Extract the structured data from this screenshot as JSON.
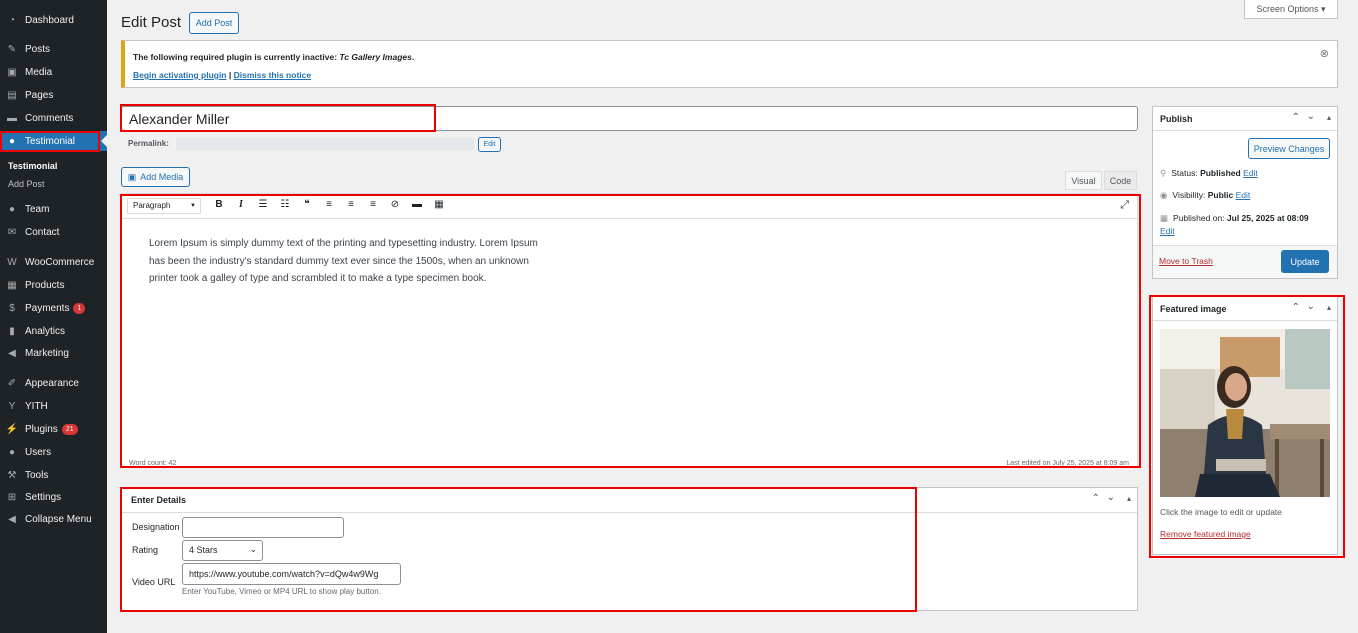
{
  "sidebar": {
    "items": [
      {
        "label": "Dashboard",
        "icon": "dashboard-icon",
        "glyph": "◔"
      },
      {
        "label": "Posts",
        "icon": "pin-icon",
        "glyph": "✎"
      },
      {
        "label": "Media",
        "icon": "media-icon",
        "glyph": "▣"
      },
      {
        "label": "Pages",
        "icon": "pages-icon",
        "glyph": "▤"
      },
      {
        "label": "Comments",
        "icon": "comments-icon",
        "glyph": "▬"
      },
      {
        "label": "Testimonial",
        "icon": "user-icon",
        "glyph": "●"
      },
      {
        "label": "Team",
        "icon": "team-icon",
        "glyph": "●"
      },
      {
        "label": "Contact",
        "icon": "mail-icon",
        "glyph": "✉"
      },
      {
        "label": "WooCommerce",
        "icon": "woo-icon",
        "glyph": "W"
      },
      {
        "label": "Products",
        "icon": "products-icon",
        "glyph": "▦"
      },
      {
        "label": "Payments",
        "icon": "payments-icon",
        "glyph": "$",
        "badge": "1"
      },
      {
        "label": "Analytics",
        "icon": "analytics-icon",
        "glyph": "▮"
      },
      {
        "label": "Marketing",
        "icon": "megaphone-icon",
        "glyph": "◀"
      },
      {
        "label": "Appearance",
        "icon": "brush-icon",
        "glyph": "✐"
      },
      {
        "label": "YITH",
        "icon": "yith-icon",
        "glyph": "Y"
      },
      {
        "label": "Plugins",
        "icon": "plugin-icon",
        "glyph": "⚡",
        "badge": "21"
      },
      {
        "label": "Users",
        "icon": "users-icon",
        "glyph": "●"
      },
      {
        "label": "Tools",
        "icon": "wrench-icon",
        "glyph": "⚒"
      },
      {
        "label": "Settings",
        "icon": "settings-icon",
        "glyph": "⊞"
      },
      {
        "label": "Collapse Menu",
        "icon": "collapse-icon",
        "glyph": "◀"
      }
    ],
    "submenu": [
      "Testimonial",
      "Add Post"
    ]
  },
  "header": {
    "title": "Edit Post",
    "add_post": "Add Post",
    "screen_options": "Screen Options ▾"
  },
  "notice": {
    "text_prefix": "The following required plugin is currently inactive: ",
    "plugin": "Tc Gallery Images",
    "text_suffix": ".",
    "link1": "Begin activating plugin",
    "sep": " | ",
    "link2": "Dismiss this notice",
    "dismiss_glyph": "⊗"
  },
  "post": {
    "title": "Alexander Miller",
    "permalink_label": "Permalink:",
    "permalink_edit": "Edit"
  },
  "editor": {
    "add_media": "Add Media",
    "tab_visual": "Visual",
    "tab_code": "Code",
    "format": "Paragraph",
    "toolbar": [
      "B",
      "I",
      "☰",
      "☷",
      "❝",
      "≡",
      "≡",
      "≡",
      "⊘",
      "▬",
      "▦"
    ],
    "content": "Lorem Ipsum is simply dummy text of the printing and typesetting industry. Lorem Ipsum has been the industry's standard dummy text ever since the 1500s, when an unknown printer took a galley of type and scrambled it to make a type specimen book.",
    "word_count": "Word count: 42",
    "last_edited": "Last edited on July 25, 2025 at 8:09 am",
    "fullscreen_glyph": "⤢"
  },
  "details": {
    "title": "Enter Details",
    "designation_label": "Designation",
    "designation_value": "",
    "rating_label": "Rating",
    "rating_value": "4 Stars",
    "video_label": "Video URL",
    "video_value": "https://www.youtube.com/watch?v=dQw4w9Wg",
    "video_hint": "Enter YouTube, Vimeo or MP4 URL to show play button."
  },
  "publish": {
    "title": "Publish",
    "preview": "Preview Changes",
    "status_label": "Status: ",
    "status_value": "Published",
    "visibility_label": "Visibility: ",
    "visibility_value": "Public",
    "published_label": "Published on: ",
    "published_value": "Jul 25, 2025 at 08:09",
    "edit": "Edit",
    "trash": "Move to Trash",
    "update": "Update"
  },
  "featured": {
    "title": "Featured image",
    "hint": "Click the image to edit or update",
    "remove": "Remove featured image"
  },
  "panel_arrows": {
    "up": "⌃",
    "down": "⌄",
    "toggle": "▴"
  },
  "colors": {
    "accent": "#2271b1",
    "highlight": "#e00000",
    "sidebar": "#1d2327",
    "badge": "#d63638"
  }
}
